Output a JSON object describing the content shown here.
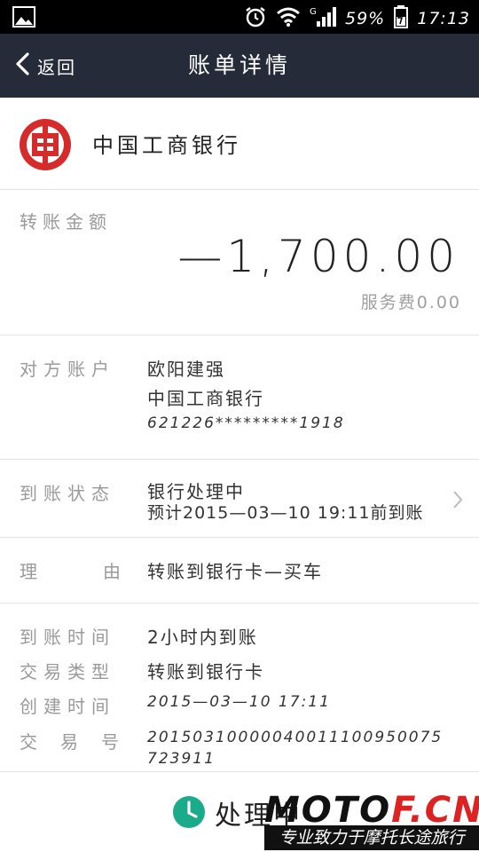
{
  "status_bar": {
    "battery": "59%",
    "time": "17:13",
    "signal_label": "G"
  },
  "nav": {
    "back_label": "返回",
    "title": "账单详情"
  },
  "bank": {
    "name": "中国工商银行",
    "logo_color": "#d62b2b"
  },
  "amount": {
    "label": "转账金额",
    "value": "—1,700.00",
    "fee": "服务费0.00"
  },
  "counterparty": {
    "label": "对方账户",
    "name": "欧阳建强",
    "bank": "中国工商银行",
    "account": "621226*********1918"
  },
  "arrival_status": {
    "label": "到账状态",
    "status": "银行处理中",
    "estimate": "预计2015—03—10 19:11前到账"
  },
  "reason": {
    "label": "理由",
    "value": "转账到银行卡—买车"
  },
  "details": {
    "arrival_time_label": "到账时间",
    "arrival_time": "2小时内到账",
    "type_label": "交易类型",
    "type": "转账到银行卡",
    "created_label": "创建时间",
    "created": "2015—03—10 17:11",
    "txn_label": "交易号",
    "txn_line1": "20150310000040011100950075",
    "txn_line2": "723911"
  },
  "bottom": {
    "status": "处理中",
    "icon_color": "#1aab8a"
  },
  "watermark": {
    "brand_a": "MOTO",
    "brand_b": "F.CN",
    "slogan": "专业致力于摩托长途旅行"
  }
}
